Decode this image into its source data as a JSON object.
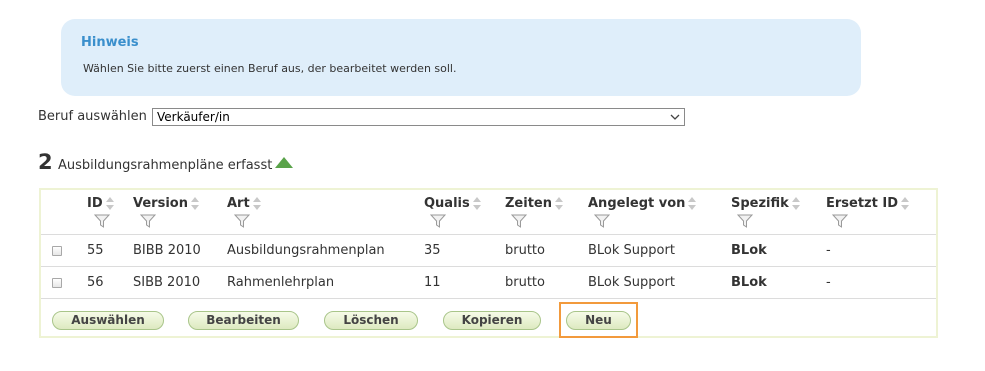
{
  "notice": {
    "title": "Hinweis",
    "text": "Wählen Sie bitte zuerst einen Beruf aus, der bearbeitet werden soll."
  },
  "beruf": {
    "label": "Beruf auswählen",
    "selected": "Verkäufer/in"
  },
  "summary": {
    "count": "2",
    "label": "Ausbildungsrahmenpläne erfasst"
  },
  "table": {
    "columns": [
      "ID",
      "Version",
      "Art",
      "Qualis",
      "Zeiten",
      "Angelegt von",
      "Spezifik",
      "Ersetzt ID"
    ],
    "rows": [
      {
        "id": "55",
        "version": "BIBB 2010",
        "art": "Ausbildungsrahmenplan",
        "qualis": "35",
        "zeiten": "brutto",
        "angelegt": "BLok Support",
        "spezifik": "BLok",
        "ersetzt": "-"
      },
      {
        "id": "56",
        "version": "SIBB 2010",
        "art": "Rahmenlehrplan",
        "qualis": "11",
        "zeiten": "brutto",
        "angelegt": "BLok Support",
        "spezifik": "BLok",
        "ersetzt": "-"
      }
    ]
  },
  "buttons": {
    "select": "Auswählen",
    "edit": "Bearbeiten",
    "delete": "Löschen",
    "copy": "Kopieren",
    "new": "Neu"
  },
  "colors": {
    "notice_bg": "#dfeefa",
    "notice_title": "#3a8fcc",
    "accent_green": "#5aa34a",
    "highlight": "#f29a3c"
  },
  "icons": {
    "filter": "funnel-icon",
    "sort": "sort-arrows-icon",
    "collapse": "triangle-up-icon",
    "dropdown": "chevron-down-icon"
  }
}
